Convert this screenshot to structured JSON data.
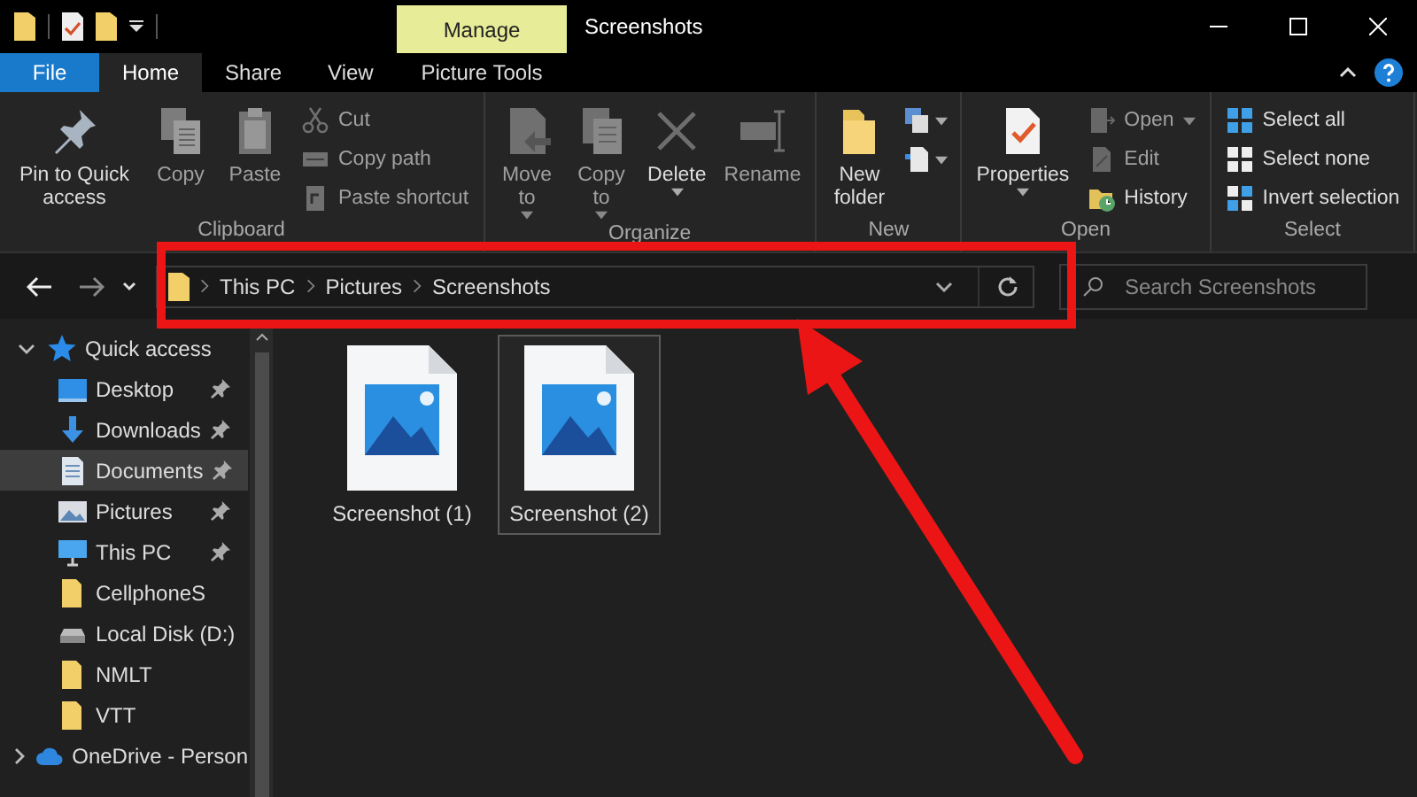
{
  "window": {
    "title": "Screenshots"
  },
  "contextual_tab": {
    "label": "Manage"
  },
  "ribbon_tabs": [
    {
      "label": "File",
      "kind": "file",
      "selected": false
    },
    {
      "label": "Home",
      "kind": "tab",
      "selected": true
    },
    {
      "label": "Share",
      "kind": "tab",
      "selected": false
    },
    {
      "label": "View",
      "kind": "tab",
      "selected": false
    },
    {
      "label": "Picture Tools",
      "kind": "tab",
      "selected": false
    }
  ],
  "ribbon_groups": [
    {
      "label": "Clipboard",
      "commands": [
        {
          "label": "Pin to Quick access",
          "kind": "large",
          "disabled": false,
          "dropdown": false
        },
        {
          "label": "Copy",
          "kind": "large",
          "disabled": true,
          "dropdown": false
        },
        {
          "label": "Paste",
          "kind": "large",
          "disabled": true,
          "dropdown": false
        },
        {
          "label": "Cut",
          "kind": "small",
          "disabled": true,
          "dropdown": false
        },
        {
          "label": "Copy path",
          "kind": "small",
          "disabled": true,
          "dropdown": false
        },
        {
          "label": "Paste shortcut",
          "kind": "small",
          "disabled": true,
          "dropdown": false
        }
      ]
    },
    {
      "label": "Organize",
      "commands": [
        {
          "label": "Move to",
          "kind": "large",
          "disabled": true,
          "dropdown": true
        },
        {
          "label": "Copy to",
          "kind": "large",
          "disabled": true,
          "dropdown": true
        },
        {
          "label": "Delete",
          "kind": "large",
          "disabled": false,
          "dropdown": true
        },
        {
          "label": "Rename",
          "kind": "large",
          "disabled": true,
          "dropdown": false
        }
      ]
    },
    {
      "label": "New",
      "commands": [
        {
          "label": "New folder",
          "kind": "large",
          "disabled": false,
          "dropdown": false
        },
        {
          "kind": "icon",
          "disabled": false,
          "dropdown": true
        },
        {
          "kind": "icon",
          "disabled": false,
          "dropdown": true
        }
      ]
    },
    {
      "label": "Open",
      "commands": [
        {
          "label": "Properties",
          "kind": "large",
          "disabled": false,
          "dropdown": true
        },
        {
          "label": "Open",
          "kind": "small",
          "disabled": true,
          "dropdown": true
        },
        {
          "label": "Edit",
          "kind": "small",
          "disabled": true,
          "dropdown": false
        },
        {
          "label": "History",
          "kind": "small",
          "disabled": false,
          "dropdown": false
        }
      ]
    },
    {
      "label": "Select",
      "commands": [
        {
          "label": "Select all",
          "kind": "small",
          "disabled": false,
          "dropdown": false
        },
        {
          "label": "Select none",
          "kind": "small",
          "disabled": false,
          "dropdown": false
        },
        {
          "label": "Invert selection",
          "kind": "small",
          "disabled": false,
          "dropdown": false
        }
      ]
    }
  ],
  "address": {
    "breadcrumbs": [
      "This PC",
      "Pictures",
      "Screenshots"
    ]
  },
  "search": {
    "placeholder": "Search Screenshots"
  },
  "sidebar": {
    "tree": [
      {
        "label": "Quick access",
        "expanded": true,
        "selected": false,
        "children": [
          {
            "label": "Desktop",
            "pinned": true,
            "selected": false
          },
          {
            "label": "Downloads",
            "pinned": true,
            "selected": false
          },
          {
            "label": "Documents",
            "pinned": true,
            "selected": true
          },
          {
            "label": "Pictures",
            "pinned": true,
            "selected": false
          },
          {
            "label": "This PC",
            "pinned": true,
            "selected": false
          },
          {
            "label": "CellphoneS",
            "pinned": false,
            "selected": false
          },
          {
            "label": "Local Disk (D:)",
            "pinned": false,
            "selected": false
          },
          {
            "label": "NMLT",
            "pinned": false,
            "selected": false
          },
          {
            "label": "VTT",
            "pinned": false,
            "selected": false
          }
        ]
      },
      {
        "label": "OneDrive - Person",
        "expanded": false,
        "selected": false
      }
    ]
  },
  "files": [
    {
      "name": "Screenshot (1)",
      "selected": false
    },
    {
      "name": "Screenshot (2)",
      "selected": true
    }
  ]
}
